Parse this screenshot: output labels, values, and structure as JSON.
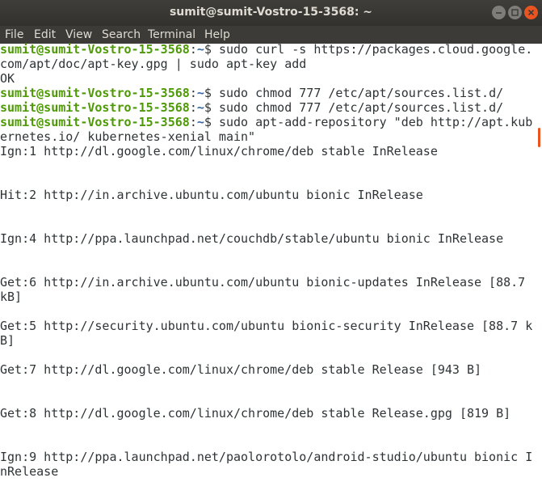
{
  "window": {
    "title": "sumit@sumit-Vostro-15-3568: ~"
  },
  "menu": {
    "items": [
      "File",
      "Edit",
      "View",
      "Search",
      "Terminal",
      "Help"
    ]
  },
  "terminal": {
    "prompt_user": "sumit@sumit-Vostro-15-3568",
    "prompt_path": "~",
    "lines": [
      {
        "kind": "prompt",
        "cmd": "sudo curl -s https://packages.cloud.google."
      },
      {
        "kind": "text",
        "text": "com/apt/doc/apt-key.gpg | sudo apt-key add"
      },
      {
        "kind": "text",
        "text": "OK"
      },
      {
        "kind": "prompt",
        "cmd": "sudo chmod 777 /etc/apt/sources.list.d/"
      },
      {
        "kind": "prompt",
        "cmd": "sudo chmod 777 /etc/apt/sources.list.d/"
      },
      {
        "kind": "prompt",
        "cmd": "sudo apt-add-repository \"deb http://apt.kub"
      },
      {
        "kind": "text",
        "text": "ernetes.io/ kubernetes-xenial main\""
      },
      {
        "kind": "text",
        "text": "Ign:1 http://dl.google.com/linux/chrome/deb stable InRelease"
      },
      {
        "kind": "text",
        "text": ""
      },
      {
        "kind": "text",
        "text": ""
      },
      {
        "kind": "text",
        "text": "Hit:2 http://in.archive.ubuntu.com/ubuntu bionic InRelease"
      },
      {
        "kind": "text",
        "text": ""
      },
      {
        "kind": "text",
        "text": ""
      },
      {
        "kind": "text",
        "text": "Ign:4 http://ppa.launchpad.net/couchdb/stable/ubuntu bionic InRelease"
      },
      {
        "kind": "text",
        "text": ""
      },
      {
        "kind": "text",
        "text": ""
      },
      {
        "kind": "text",
        "text": "Get:6 http://in.archive.ubuntu.com/ubuntu bionic-updates InRelease [88.7"
      },
      {
        "kind": "text",
        "text": "kB]"
      },
      {
        "kind": "text",
        "text": ""
      },
      {
        "kind": "text",
        "text": "Get:5 http://security.ubuntu.com/ubuntu bionic-security InRelease [88.7 k"
      },
      {
        "kind": "text",
        "text": "B]"
      },
      {
        "kind": "text",
        "text": ""
      },
      {
        "kind": "text",
        "text": "Get:7 http://dl.google.com/linux/chrome/deb stable Release [943 B]"
      },
      {
        "kind": "text",
        "text": ""
      },
      {
        "kind": "text",
        "text": ""
      },
      {
        "kind": "text",
        "text": "Get:8 http://dl.google.com/linux/chrome/deb stable Release.gpg [819 B]"
      },
      {
        "kind": "text",
        "text": ""
      },
      {
        "kind": "text",
        "text": ""
      },
      {
        "kind": "text",
        "text": "Ign:9 http://ppa.launchpad.net/paolorotolo/android-studio/ubuntu bionic I"
      },
      {
        "kind": "text",
        "text": "nRelease"
      }
    ]
  },
  "colors": {
    "prompt_user": "#4e9a06",
    "prompt_path": "#3465a4",
    "close_button": "#e95420",
    "scrollbar": "#e95420"
  },
  "icons": {
    "minimize": "minimize-icon",
    "maximize": "maximize-icon",
    "close": "close-icon"
  }
}
